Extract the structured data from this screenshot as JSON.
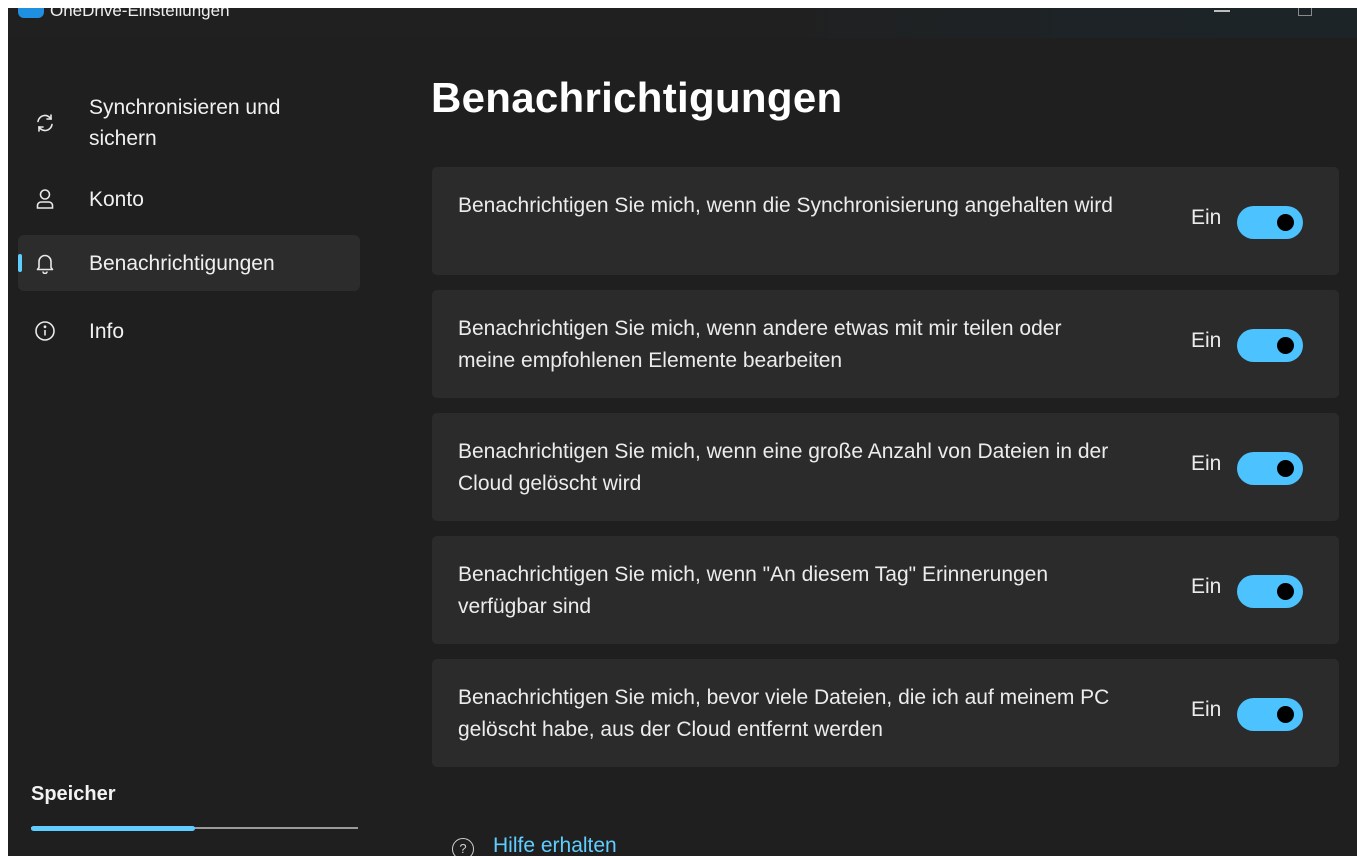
{
  "window": {
    "title": "OneDrive-Einstellungen"
  },
  "sidebar": {
    "items": [
      {
        "label": "Synchronisieren und\nsichern",
        "icon": "sync-icon",
        "active": false
      },
      {
        "label": "Konto",
        "icon": "person-icon",
        "active": false
      },
      {
        "label": "Benachrichtigungen",
        "icon": "bell-icon",
        "active": true
      },
      {
        "label": "Info",
        "icon": "info-icon",
        "active": false
      }
    ],
    "storage": {
      "label": "Speicher",
      "fill_fraction": 0.5
    }
  },
  "main": {
    "title": "Benachrichtigungen",
    "settings": [
      {
        "text": "Benachrichtigen Sie mich, wenn die Synchronisierung angehalten wird",
        "state": "Ein",
        "on": true
      },
      {
        "text": "Benachrichtigen Sie mich, wenn andere etwas mit mir teilen oder meine empfohlenen Elemente bearbeiten",
        "state": "Ein",
        "on": true
      },
      {
        "text": "Benachrichtigen Sie mich, wenn eine große Anzahl von Dateien in der Cloud gelöscht wird",
        "state": "Ein",
        "on": true
      },
      {
        "text": "Benachrichtigen Sie mich, wenn \"An diesem Tag\" Erinnerungen verfügbar sind",
        "state": "Ein",
        "on": true
      },
      {
        "text": "Benachrichtigen Sie mich, bevor viele Dateien, die ich auf meinem PC gelöscht habe, aus der Cloud entfernt werden",
        "state": "Ein",
        "on": true
      }
    ],
    "help": {
      "icon": "help-circle-icon",
      "label": "Hilfe erhalten"
    }
  },
  "colors": {
    "accent": "#4cc2ff",
    "link": "#60cdff",
    "background": "#1f1f1f",
    "card": "#2b2b2b"
  }
}
